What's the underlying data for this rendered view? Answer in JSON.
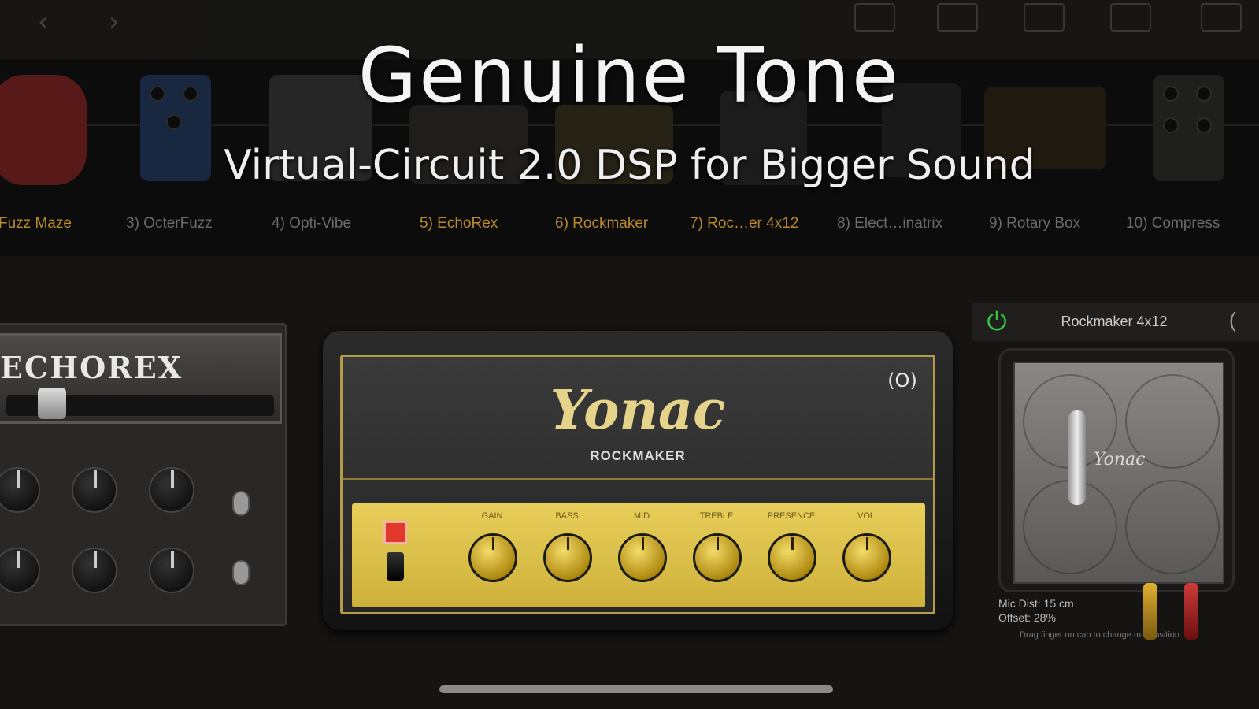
{
  "promo": {
    "title": "Genuine Tone",
    "subtitle": "Virtual-Circuit 2.0 DSP for Bigger Sound"
  },
  "pedal_strip": {
    "slots": [
      {
        "label": "Fuzz Maze",
        "active": true
      },
      {
        "label": "3) OcterFuzz",
        "active": false
      },
      {
        "label": "4) Opti-Vibe",
        "active": false
      },
      {
        "label": "5) EchoRex",
        "active": true
      },
      {
        "label": "6) Rockmaker",
        "active": true
      },
      {
        "label": "7) Roc…er 4x12",
        "active": true
      },
      {
        "label": "8) Elect…inatrix",
        "active": false
      },
      {
        "label": "9) Rotary Box",
        "active": false
      },
      {
        "label": "10) Compress",
        "active": false
      }
    ]
  },
  "echo_unit": {
    "name": "ECHOREX"
  },
  "amp": {
    "brand": "Yonac",
    "model": "ROCKMAKER",
    "power_symbol": "(O)",
    "knobs": [
      "GAIN",
      "BASS",
      "MID",
      "TREBLE",
      "PRESENCE",
      "VOL"
    ]
  },
  "cabinet": {
    "title": "Rockmaker 4x12",
    "brand": "Yonac",
    "mic_distance": "Mic Dist: 15 cm",
    "mic_offset": "Offset: 28%",
    "hint": "Drag finger on cab to change mic position"
  },
  "colors": {
    "accent_gold": "#e5d38a",
    "power_green": "#34c940",
    "slot_active": "#b88a2c"
  }
}
